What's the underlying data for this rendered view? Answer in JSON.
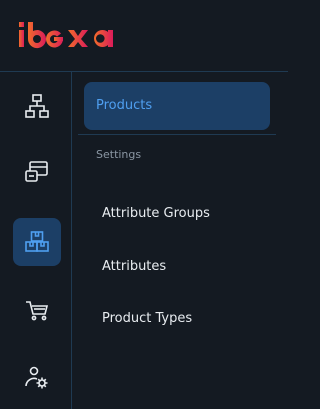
{
  "brand": {
    "logo_text": "ibexa",
    "colors": {
      "gradient_start": "#f26c2b",
      "gradient_end": "#db1c5a"
    }
  },
  "rail": {
    "items": [
      {
        "icon": "sitemap-icon",
        "active": false
      },
      {
        "icon": "content-icon",
        "active": false
      },
      {
        "icon": "product-boxes-icon",
        "active": true
      },
      {
        "icon": "cart-icon",
        "active": false
      },
      {
        "icon": "user-settings-icon",
        "active": false
      }
    ]
  },
  "panel": {
    "primary_item": "Products",
    "section_label": "Settings",
    "items": [
      "Attribute Groups",
      "Attributes",
      "Product Types"
    ]
  },
  "colors": {
    "accent": "#4f9ff0",
    "active_bg": "#1c3f66",
    "background": "#141a22"
  }
}
